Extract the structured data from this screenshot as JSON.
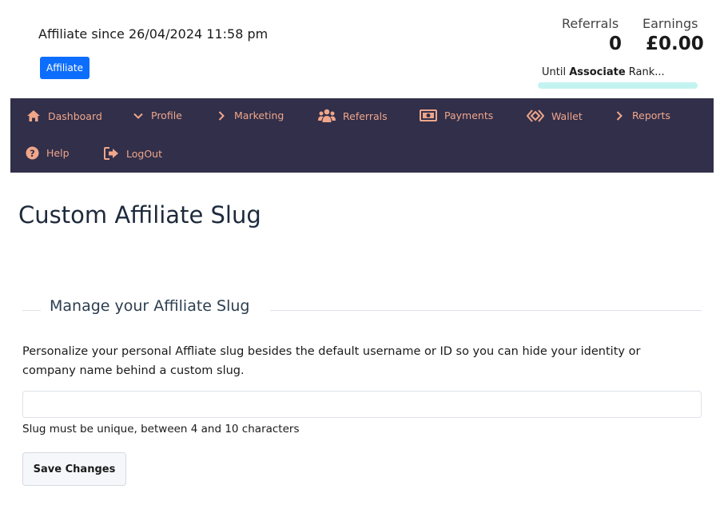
{
  "header": {
    "affiliate_since": "Affiliate since 26/04/2024 11:58 pm",
    "badge": "Affiliate",
    "referrals_label": "Referrals",
    "referrals_value": "0",
    "earnings_label": "Earnings",
    "earnings_value": "£0.00",
    "rank_prefix": "Until",
    "rank_name": "Associate",
    "rank_suffix": "Rank...",
    "rank_bar_color": "#c3f3f0"
  },
  "nav": {
    "background": "#312f4a",
    "text_color": "#f0a68a",
    "items": [
      {
        "label": "Dashboard",
        "icon": "home-icon"
      },
      {
        "label": "Profile",
        "icon": "chevron-down-icon"
      },
      {
        "label": "Marketing",
        "icon": "chevron-right-icon"
      },
      {
        "label": "Referrals",
        "icon": "users-icon"
      },
      {
        "label": "Payments",
        "icon": "money-bill-icon"
      },
      {
        "label": "Wallet",
        "icon": "diamond-icon"
      },
      {
        "label": "Reports",
        "icon": "chevron-right-icon"
      },
      {
        "label": "Help",
        "icon": "question-circle-icon"
      },
      {
        "label": "LogOut",
        "icon": "sign-out-icon"
      }
    ]
  },
  "main": {
    "title": "Custom Affiliate Slug",
    "section_legend": "Manage your Affiliate Slug",
    "description": "Personalize your personal Affliate slug besides the default username or ID so you can hide your identity or company name behind a custom slug.",
    "slug_input_value": "",
    "slug_hint": "Slug must be unique, between 4 and 10 characters",
    "save_button": "Save Changes"
  }
}
